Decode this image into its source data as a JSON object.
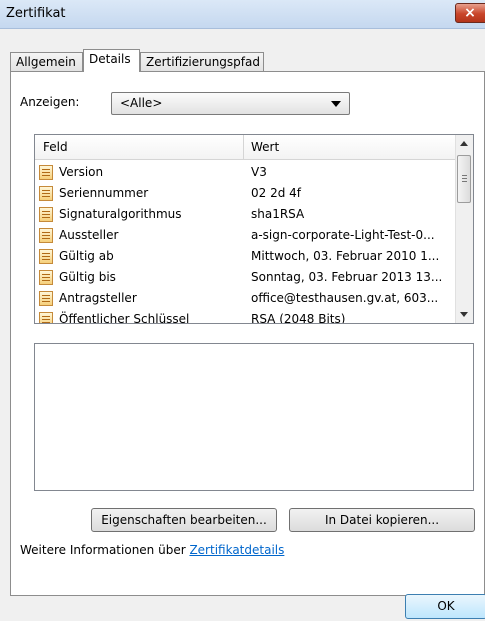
{
  "window": {
    "title": "Zertifikat",
    "close_symbol": "×"
  },
  "tabs": [
    {
      "label": "Allgemein",
      "active": false
    },
    {
      "label": "Details",
      "active": true
    },
    {
      "label": "Zertifizierungspfad",
      "active": false
    }
  ],
  "show": {
    "label": "Anzeigen:",
    "selected": "<Alle>"
  },
  "list": {
    "columns": [
      "Feld",
      "Wert"
    ],
    "rows": [
      {
        "field": "Version",
        "value": "V3"
      },
      {
        "field": "Seriennummer",
        "value": "02 2d 4f"
      },
      {
        "field": "Signaturalgorithmus",
        "value": "sha1RSA"
      },
      {
        "field": "Aussteller",
        "value": "a-sign-corporate-Light-Test-0..."
      },
      {
        "field": "Gültig ab",
        "value": "Mittwoch, 03. Februar 2010 1..."
      },
      {
        "field": "Gültig bis",
        "value": "Sonntag, 03. Februar 2013 13..."
      },
      {
        "field": "Antragsteller",
        "value": "office@testhausen.gv.at, 603..."
      },
      {
        "field": "Öffentlicher Schlüssel",
        "value": "RSA (2048 Bits)"
      }
    ]
  },
  "buttons": {
    "edit_properties": "Eigenschaften bearbeiten...",
    "copy_to_file": "In Datei kopieren...",
    "ok": "OK"
  },
  "more_info": {
    "text": "Weitere Informationen über ",
    "link": "Zertifikatdetails"
  },
  "icons": {
    "row_icon": "certificate-field-icon"
  },
  "colors": {
    "link": "#0066cc",
    "close_button": "#c9452a"
  }
}
